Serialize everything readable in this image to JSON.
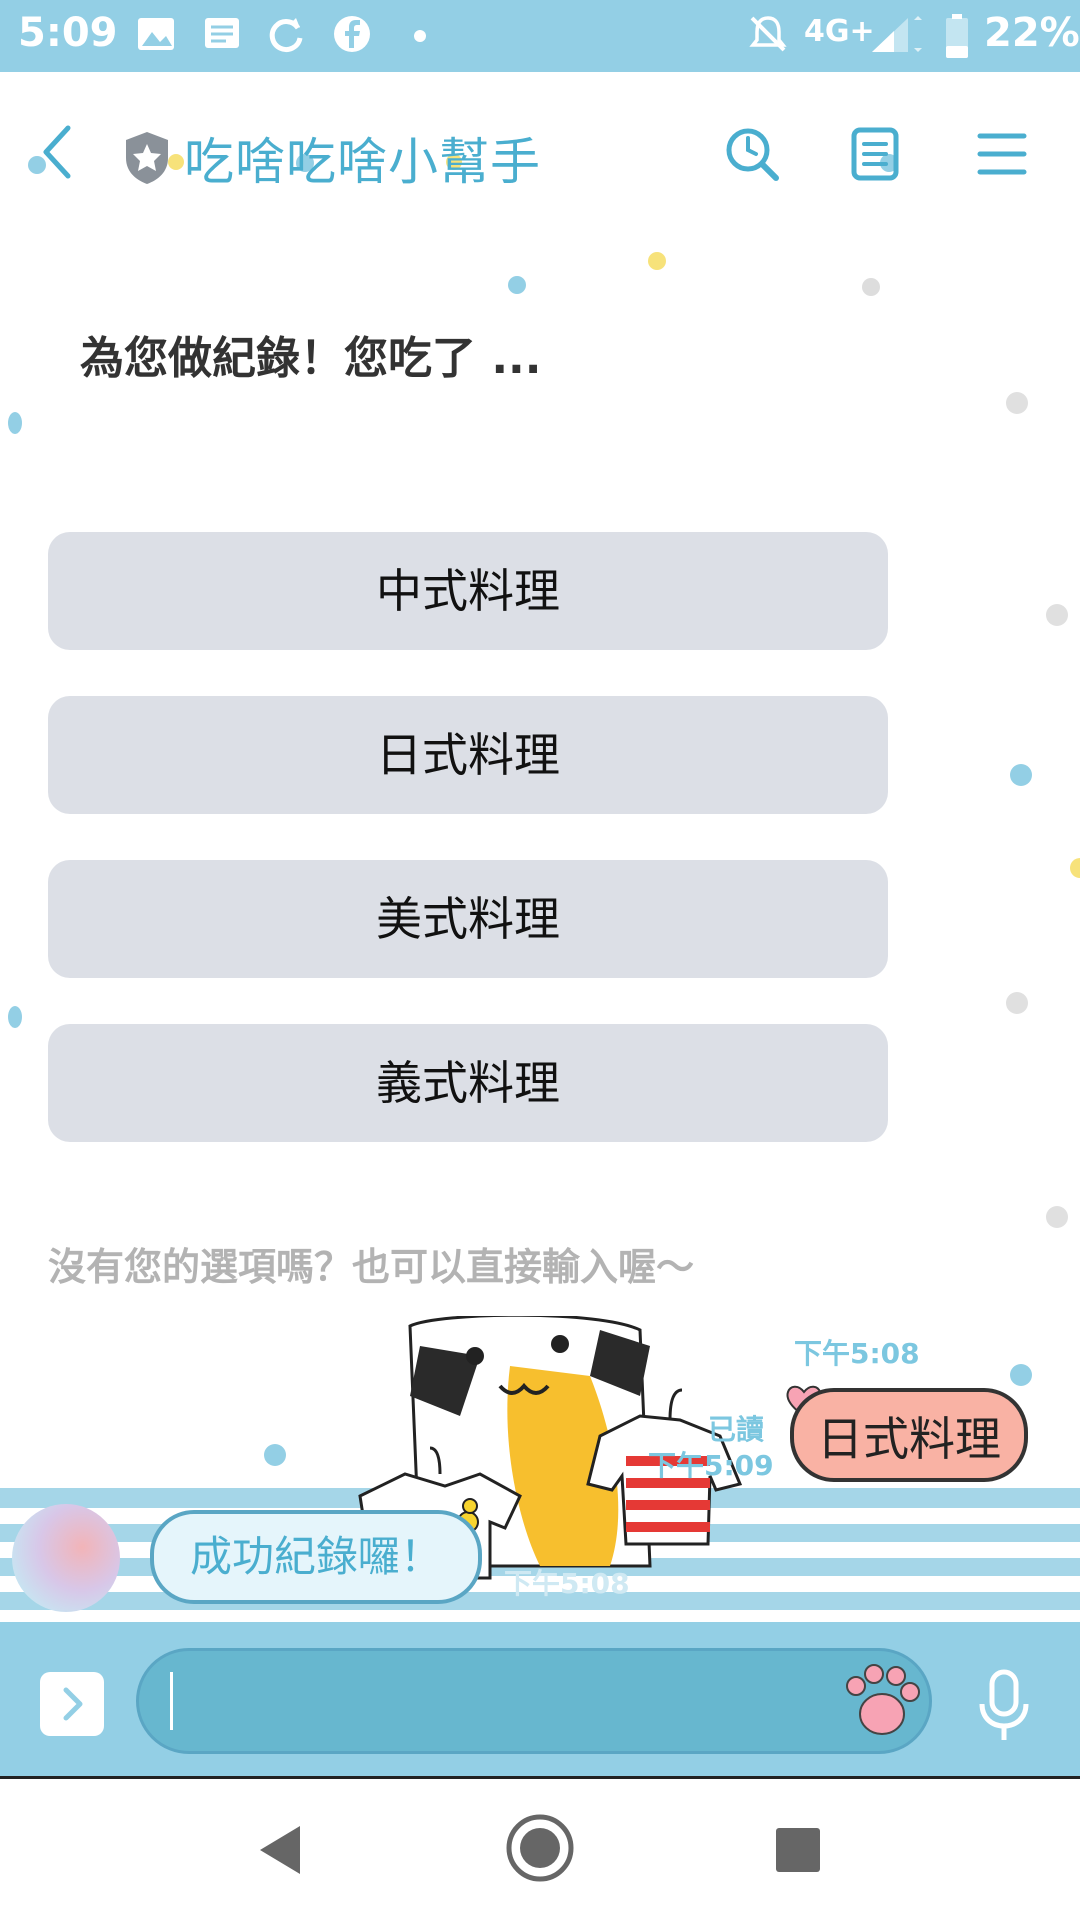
{
  "status_bar": {
    "time": "5:09",
    "network": "4G+",
    "battery": "22%"
  },
  "header": {
    "title": "吃啥吃啥小幫手"
  },
  "card": {
    "prompt": "為您做紀錄！您吃了 ...",
    "options": [
      "中式料理",
      "日式料理",
      "美式料理",
      "義式料理"
    ],
    "note": "沒有您的選項嗎？也可以直接輸入喔～"
  },
  "messages": {
    "user": {
      "text": "日式料理",
      "time": "下午5:08",
      "read": "已讀",
      "read_time": "下午5:09"
    },
    "bot": {
      "text": "成功紀錄囉！",
      "time": "下午5:08"
    }
  },
  "colors": {
    "accent": "#4aaecf",
    "status_bar": "#93cfe5",
    "option_button": "#dcdfe6",
    "user_bubble": "#f9b2a4",
    "bot_bubble": "#e5f5fb"
  },
  "icons": {
    "back": "chevron-left-icon",
    "official_badge": "shield-star-icon",
    "search": "search-icon",
    "notes": "note-icon",
    "menu": "menu-icon",
    "expand": "chevron-right-icon",
    "sticker": "paw-icon",
    "mic": "microphone-icon"
  }
}
